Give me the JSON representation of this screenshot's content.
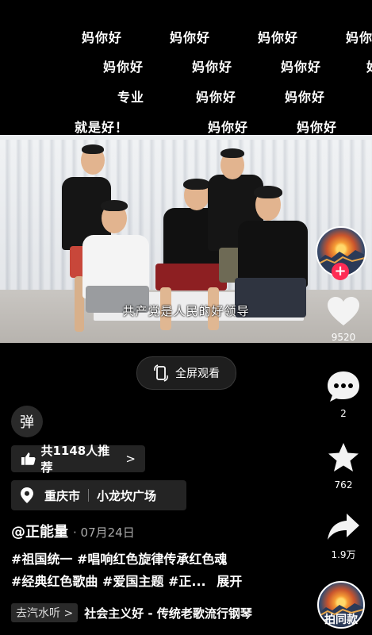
{
  "danmaku": [
    {
      "text": "妈你好"
    },
    {
      "text": "妈你好"
    },
    {
      "text": "妈你好"
    },
    {
      "text": "妈你"
    },
    {
      "text": "妈你好"
    },
    {
      "text": "妈你好"
    },
    {
      "text": "妈你好"
    },
    {
      "text": "好"
    },
    {
      "text": "专业"
    },
    {
      "text": "妈你好"
    },
    {
      "text": "妈你好"
    },
    {
      "text": "就是好！"
    },
    {
      "text": "妈你好"
    },
    {
      "text": "妈你好"
    }
  ],
  "video": {
    "subtitle": "共产党是人民的好领导",
    "fullscreen_label": "全屏观看"
  },
  "actions": {
    "likes": "9520",
    "comments": "2",
    "favorites": "762",
    "shares": "1.9万",
    "remix_label": "拍同款"
  },
  "danmaku_toggle": "弹",
  "recommend": {
    "label": "共1148人推荐",
    "chevron": ">"
  },
  "location": {
    "city": "重庆市",
    "place": "小龙坎广场"
  },
  "post": {
    "author": "@正能量",
    "date": "· 07月24日",
    "tags_line1": "#祖国统一 #唱响红色旋律传承红色魂",
    "tags_line2": "#经典红色歌曲 #爱国主题 #正...",
    "expand": "展开"
  },
  "music": {
    "source_chip": "去汽水听 >",
    "title": "社会主义好 - 传统老歌流行钢琴"
  },
  "colors": {
    "accent": "#fe2c55",
    "background": "#000000"
  }
}
